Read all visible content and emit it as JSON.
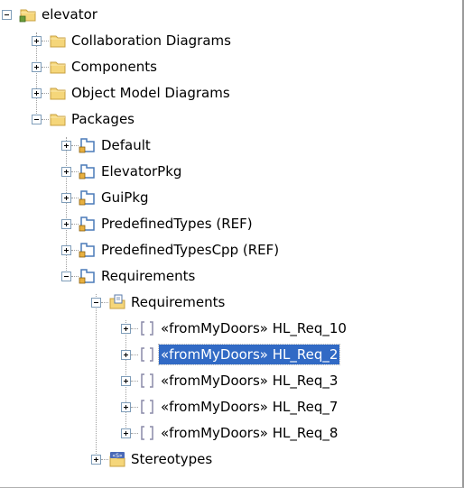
{
  "tree": [
    {
      "label": "elevator",
      "icon": "project-folder-icon",
      "level": 0,
      "expander": "minus"
    },
    {
      "label": "Collaboration Diagrams",
      "icon": "folder-icon",
      "level": 1,
      "expander": "plus"
    },
    {
      "label": "Components",
      "icon": "folder-icon",
      "level": 1,
      "expander": "plus"
    },
    {
      "label": "Object Model Diagrams",
      "icon": "folder-icon",
      "level": 1,
      "expander": "plus"
    },
    {
      "label": "Packages",
      "icon": "folder-icon",
      "level": 1,
      "expander": "minus"
    },
    {
      "label": "Default",
      "icon": "package-icon",
      "level": 2,
      "expander": "plus"
    },
    {
      "label": "ElevatorPkg",
      "icon": "package-icon",
      "level": 2,
      "expander": "plus"
    },
    {
      "label": "GuiPkg",
      "icon": "package-icon",
      "level": 2,
      "expander": "plus"
    },
    {
      "label": "PredefinedTypes (REF)",
      "icon": "package-icon",
      "level": 2,
      "expander": "plus"
    },
    {
      "label": "PredefinedTypesCpp (REF)",
      "icon": "package-icon",
      "level": 2,
      "expander": "plus"
    },
    {
      "label": "Requirements",
      "icon": "package-icon",
      "level": 2,
      "expander": "minus"
    },
    {
      "label": "Requirements",
      "icon": "requirements-folder-icon",
      "level": 3,
      "expander": "minus"
    },
    {
      "label": "«fromMyDoors» HL_Req_10",
      "icon": "requirement-icon",
      "level": 4,
      "expander": "plus"
    },
    {
      "label": "«fromMyDoors» HL_Req_2",
      "icon": "requirement-icon",
      "level": 4,
      "expander": "plus",
      "selected": true
    },
    {
      "label": "«fromMyDoors» HL_Req_3",
      "icon": "requirement-icon",
      "level": 4,
      "expander": "plus"
    },
    {
      "label": "«fromMyDoors» HL_Req_7",
      "icon": "requirement-icon",
      "level": 4,
      "expander": "plus"
    },
    {
      "label": "«fromMyDoors» HL_Req_8",
      "icon": "requirement-icon",
      "level": 4,
      "expander": "plus"
    },
    {
      "label": "Stereotypes",
      "icon": "stereotypes-folder-icon",
      "level": 3,
      "expander": "plus"
    }
  ],
  "colors": {
    "selection": "#316ac5",
    "folder": "#f5d67a",
    "folder_border": "#c8a040",
    "package_blue": "#4a7ab8"
  }
}
